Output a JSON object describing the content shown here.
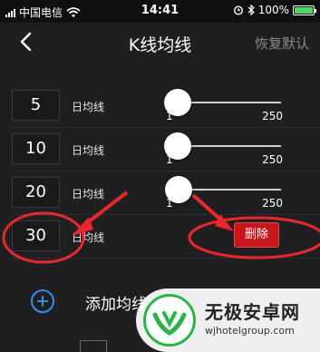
{
  "status_bar": {
    "carrier": "中国电信",
    "time": "14:41",
    "battery": "100%"
  },
  "nav": {
    "back_icon": "chevron-left-icon",
    "title": "K线均线",
    "reset_label": "恢复默认"
  },
  "ma_rows": [
    {
      "period": "5",
      "label": "日均线",
      "min_label": "1",
      "max_label": "250",
      "value_fraction": 0.02
    },
    {
      "period": "10",
      "label": "日均线",
      "min_label": "1",
      "max_label": "250",
      "value_fraction": 0.04
    },
    {
      "period": "20",
      "label": "日均线",
      "min_label": "1",
      "max_label": "250",
      "value_fraction": 0.08
    },
    {
      "period": "30",
      "label": "日均线"
    }
  ],
  "delete_label": "删除",
  "add_row": {
    "icon": "plus-circle-icon",
    "label": "添加均线"
  },
  "watermark": {
    "title": "无极安卓网",
    "url": "wjhotelgroup.com"
  },
  "colors": {
    "background": "#1f1f21",
    "accent": "#2f8ef0",
    "delete": "#c8171c",
    "annotation": "#e8282d"
  }
}
